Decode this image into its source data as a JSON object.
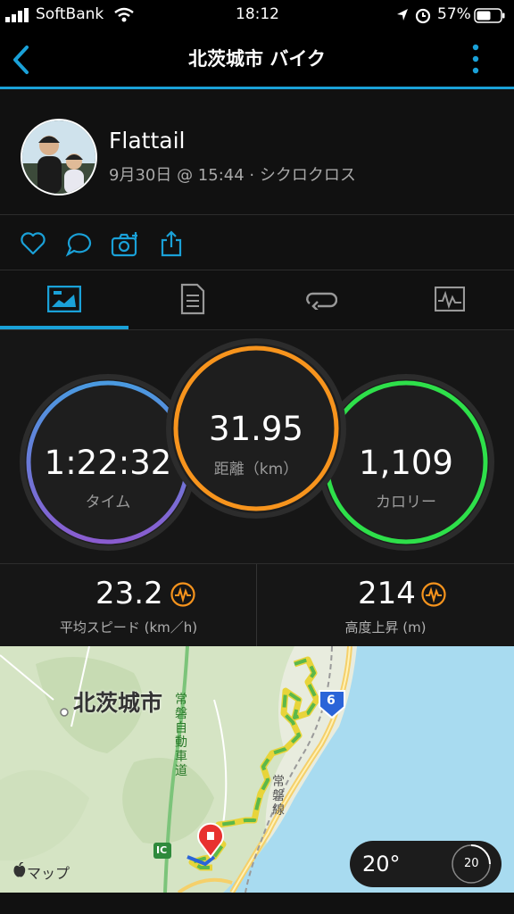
{
  "status": {
    "carrier": "SoftBank",
    "time": "18:12",
    "battery": "57%"
  },
  "nav": {
    "title": "北茨城市 バイク",
    "back_icon": "chevron-left-icon",
    "more_icon": "more-vertical-icon"
  },
  "profile": {
    "name": "Flattail",
    "meta": "9月30日 @ 15:44 · シクロクロス"
  },
  "actions": [
    "heart-icon",
    "comment-icon",
    "camera-add-icon",
    "share-icon"
  ],
  "tabs": [
    "overview-tab-icon",
    "details-tab-icon",
    "laps-tab-icon",
    "charts-tab-icon"
  ],
  "metrics": {
    "time": {
      "value": "1:22:32",
      "label": "タイム"
    },
    "distance": {
      "value": "31.95",
      "label": "距離（km）"
    },
    "calories": {
      "value": "1,109",
      "label": "カロリー"
    }
  },
  "summary": {
    "speed": {
      "value": "23.2",
      "label": "平均スピード (km／h)"
    },
    "elevation": {
      "value": "214",
      "label": "高度上昇 (m)"
    }
  },
  "map": {
    "city_label": "北茨城市",
    "expressway_label": "常磐自動車道",
    "railway_label": "常磐線",
    "ic_label": "IC",
    "route_number": "6",
    "attribution": "マップ",
    "weather": {
      "temp": "20°",
      "wind": "20"
    }
  },
  "colors": {
    "accent": "#1aa1d8",
    "time_ring": "#6a7fd8",
    "distance_ring": "#f7941d",
    "calorie_ring": "#2ee04a",
    "sea": "#a8dbf0"
  }
}
